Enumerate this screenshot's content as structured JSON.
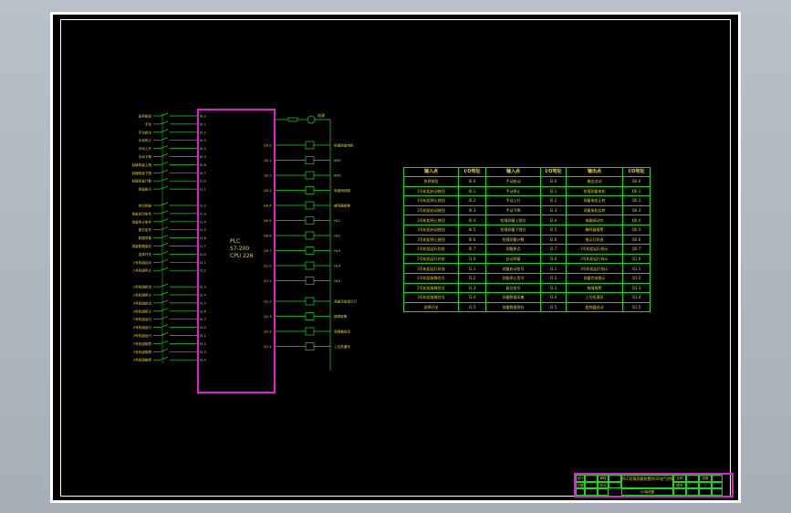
{
  "colors": {
    "border_magenta": "#e020d4",
    "line_green": "#19d81b",
    "text_yellow": "#e0d23a",
    "background": "#000000"
  },
  "plc": {
    "label": "PLC",
    "model": "S7-200",
    "cpu": "CPU 226"
  },
  "io_table": {
    "headers": [
      "输入点",
      "I/O地址",
      "输入点",
      "I/O地址",
      "输出点",
      "I/O地址"
    ],
    "rows": [
      [
        "急停按钮",
        "I0.0",
        "手动启动",
        "I2.0",
        "输出点动",
        "Q0.0"
      ],
      [
        "1号机组启动按钮",
        "I0.1",
        "手动停止",
        "I2.1",
        "铅锤测量电机",
        "Q0.1"
      ],
      [
        "1号机组停止按钮",
        "I0.2",
        "手动上升",
        "I2.2",
        "测量电机正转",
        "Q0.2"
      ],
      [
        "2号机组启动按钮",
        "I0.3",
        "手动下降",
        "I2.3",
        "测量电机反转",
        "Q0.3"
      ],
      [
        "2号机组停止按钮",
        "I0.4",
        "铅锤测量上限位",
        "I2.4",
        "电磁阀动作",
        "Q0.4"
      ],
      [
        "3号机组启动按钮",
        "I0.5",
        "铅锤测量下限位",
        "I2.5",
        "蜂鸣器报警",
        "Q0.5"
      ],
      [
        "3号机组停止按钮",
        "I0.6",
        "铅锤测量计数",
        "I2.6",
        "指示灯状态",
        "Q0.6"
      ],
      [
        "1号机组运行状态",
        "I0.7",
        "测量原点",
        "I2.7",
        "1号机组运行指示",
        "Q0.7"
      ],
      [
        "2号机组运行状态",
        "I1.0",
        "自动测量",
        "I3.0",
        "2号机组运行指示",
        "Q1.0"
      ],
      [
        "3号机组运行状态",
        "I1.1",
        "测量启动信号",
        "I3.1",
        "3号机组运行指示",
        "Q1.1"
      ],
      [
        "1号机组故障信号",
        "I1.2",
        "测量停止信号",
        "I3.2",
        "测量完成指示",
        "Q1.2"
      ],
      [
        "2号机组故障信号",
        "I1.3",
        "复位信号",
        "I3.3",
        "故障报警",
        "Q1.3"
      ],
      [
        "3号机组故障信号",
        "I1.4",
        "测量数据采集",
        "I3.4",
        "上位机通讯",
        "Q1.4"
      ],
      [
        "选择开关",
        "I1.5",
        "测量数据保存",
        "I3.5",
        "变频器启动",
        "Q1.5"
      ]
    ]
  },
  "inputs_left": [
    "急停按钮",
    "手动",
    "手动启动",
    "手动停止",
    "手动上升",
    "手动下降",
    "铅锤测量上限",
    "铅锤测量下限",
    "铅锤测量计数",
    "测量原点",
    "自动测量",
    "测量启动信号",
    "测量停止信号",
    "复位信号",
    "数据采集",
    "测量数据保存",
    "选择开关",
    "1号机组启动",
    "1号机组停止",
    "2号机组启动",
    "2号机组停止",
    "3号机组启动",
    "3号机组停止",
    "1号机组运行",
    "2号机组运行",
    "3号机组运行",
    "1号机组故障",
    "2号机组故障",
    "3号机组故障"
  ],
  "input_addresses": [
    "I0.0",
    "I0.1",
    "I0.2",
    "I0.3",
    "I0.4",
    "I0.5",
    "I0.6",
    "I0.7",
    "I1.0",
    "I1.1",
    "I1.2",
    "I1.3",
    "I1.4",
    "I1.5",
    "I1.6",
    "I1.7",
    "I2.0",
    "I2.1",
    "I2.2",
    "I2.3",
    "I2.4",
    "I2.5",
    "I2.6",
    "I2.7",
    "I3.0",
    "I3.1",
    "I3.2",
    "I3.3",
    "I3.4"
  ],
  "outputs_right": [
    "铅锤测量电机",
    "KM1",
    "KM2",
    "电磁阀线圈",
    "蜂鸣器报警",
    "HL1",
    "HL2",
    "HL3",
    "HL4",
    "HL5",
    "测量完成指示灯",
    "故障报警",
    "变频器启动",
    "上位机通讯"
  ],
  "output_addresses": [
    "Q0.0",
    "Q0.1",
    "Q0.2",
    "Q0.3",
    "Q0.4",
    "Q0.5",
    "Q0.6",
    "Q0.7",
    "Q1.0",
    "Q1.1",
    "Q1.2",
    "Q1.3",
    "Q1.4",
    "Q1.5"
  ],
  "power_label": "电源",
  "title_block": {
    "cells": [
      "设计",
      "",
      "审核",
      "",
      "比例",
      "",
      "张数",
      "",
      "日期",
      "",
      "校对",
      "",
      "图号",
      "",
      "1"
    ],
    "title": "PLC铅锤测量装置的I/O电气控制图",
    "subtitle": "I/O接线图"
  }
}
